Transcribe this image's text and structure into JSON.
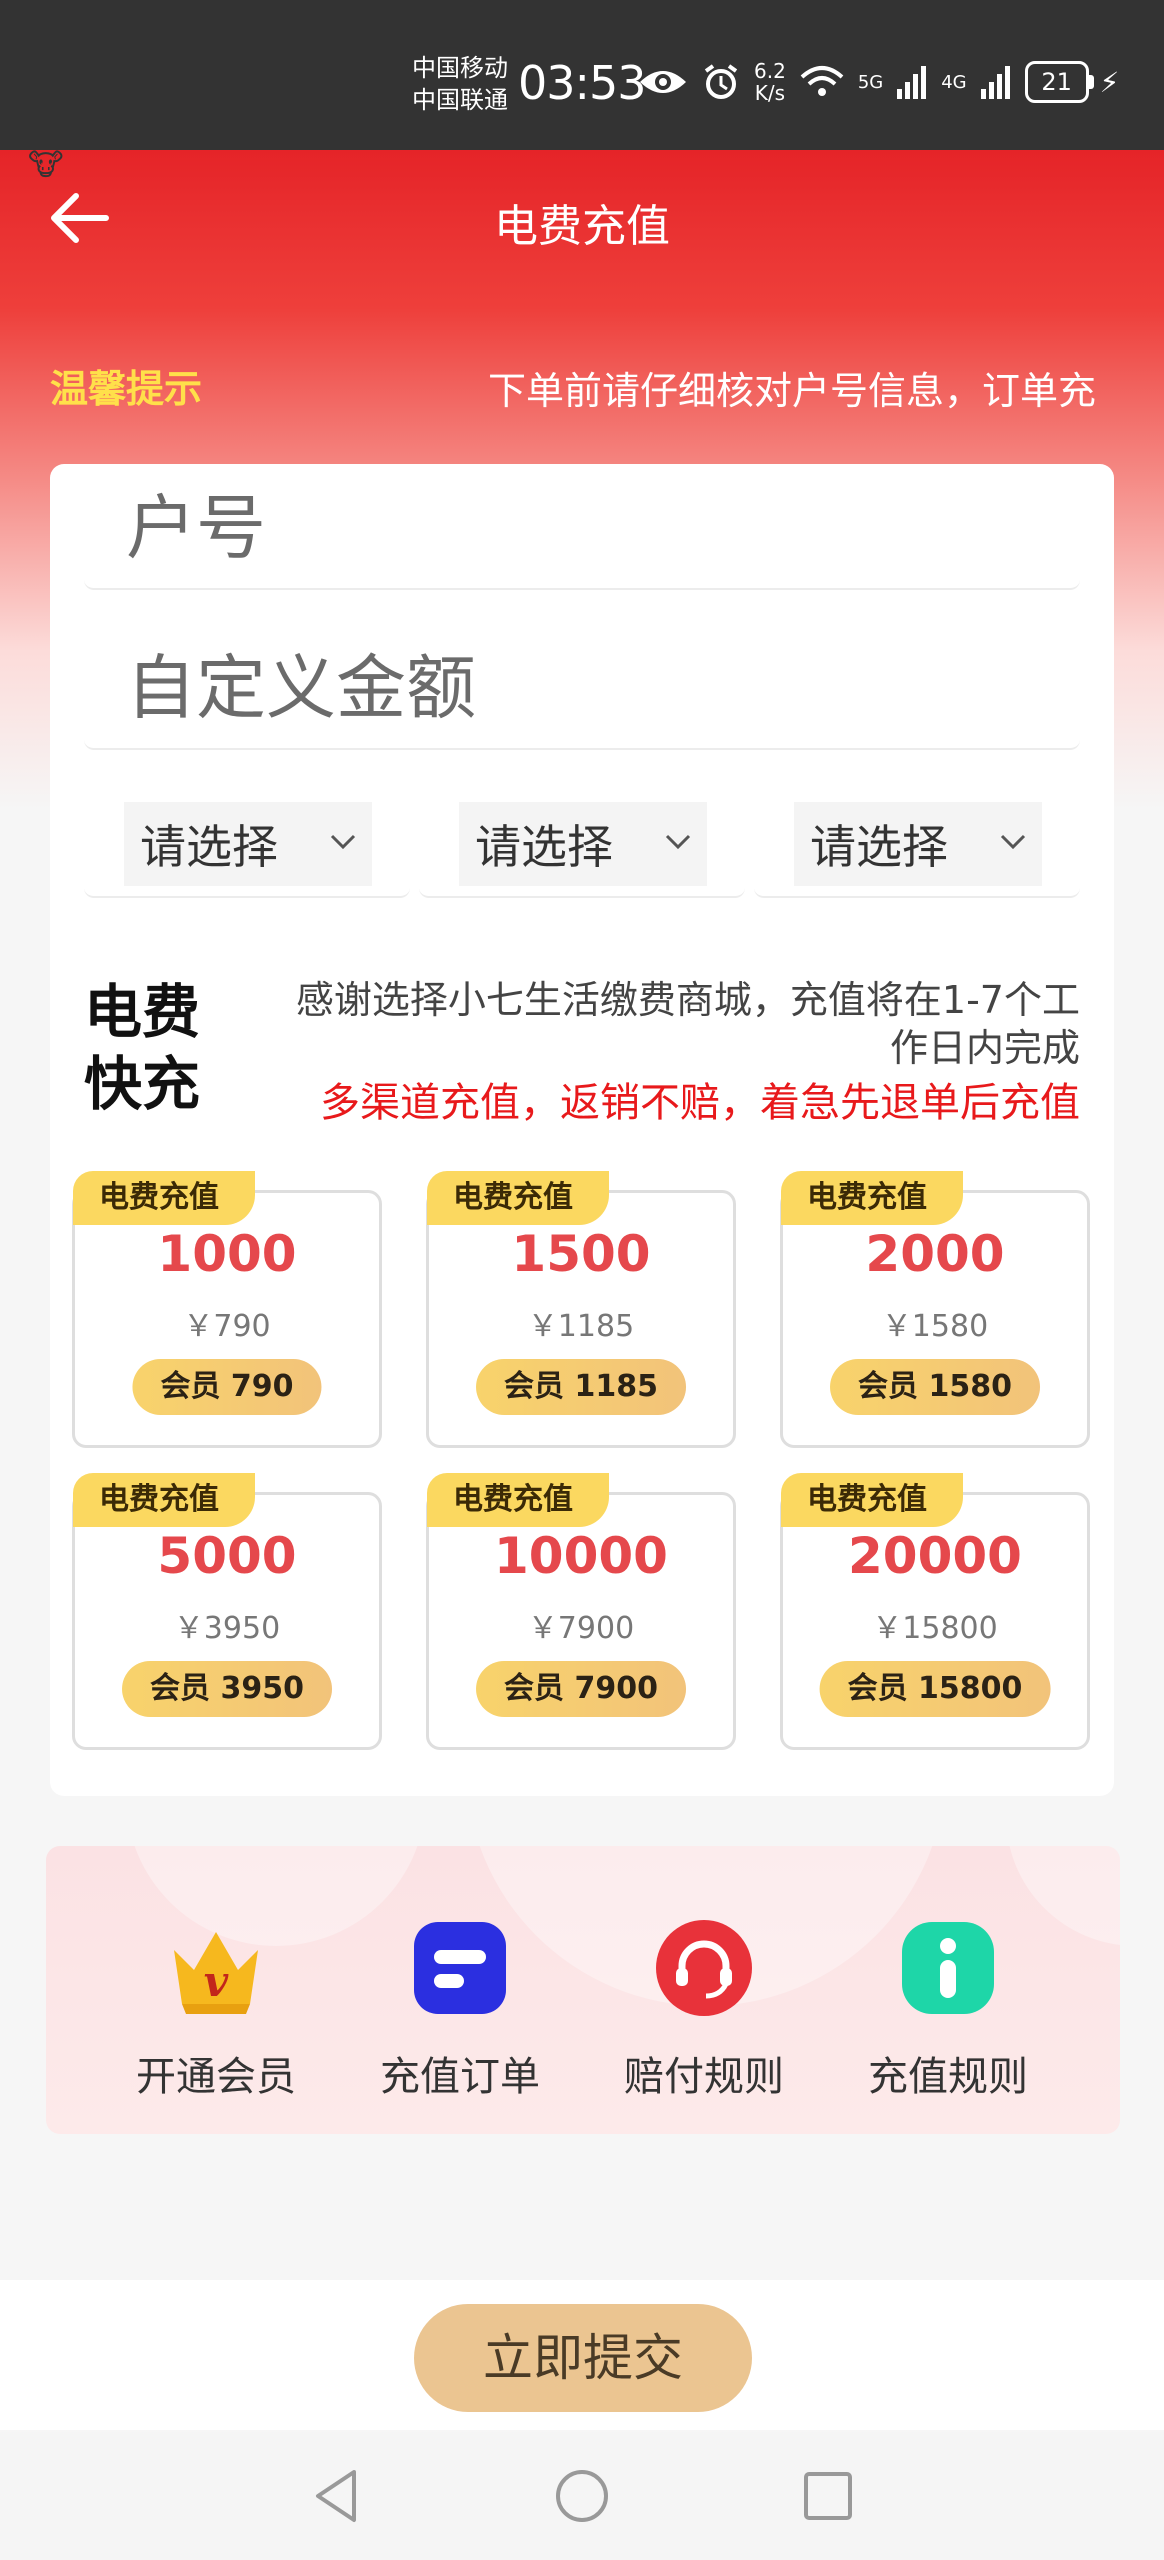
{
  "status_bar": {
    "carrier_1": "中国移动",
    "carrier_2": "中国联通",
    "time": "03:53",
    "speed_value": "6.2",
    "speed_unit": "K/s",
    "net_1": "5G",
    "net_2": "4G",
    "battery": "21"
  },
  "header": {
    "title": "电费充值",
    "tip_label": "温馨提示",
    "tip_text": "下单前请仔细核对户号信息，订单充"
  },
  "form": {
    "account_placeholder": "户号",
    "amount_placeholder": "自定义金额",
    "select_1": "请选择",
    "select_2": "请选择",
    "select_3": "请选择"
  },
  "quick": {
    "title": "电费快充",
    "desc": "感谢选择小七生活缴费商城，充值将在1-7个工作日内完成",
    "warning": "多渠道充值，返销不赔，着急先退单后充值"
  },
  "products": [
    {
      "badge": "电费充值",
      "amount": "1000",
      "price": "￥790",
      "member": "会员 790"
    },
    {
      "badge": "电费充值",
      "amount": "1500",
      "price": "￥1185",
      "member": "会员 1185"
    },
    {
      "badge": "电费充值",
      "amount": "2000",
      "price": "￥1580",
      "member": "会员 1580"
    },
    {
      "badge": "电费充值",
      "amount": "5000",
      "price": "￥3950",
      "member": "会员 3950"
    },
    {
      "badge": "电费充值",
      "amount": "10000",
      "price": "￥7900",
      "member": "会员 7900"
    },
    {
      "badge": "电费充值",
      "amount": "20000",
      "price": "￥15800",
      "member": "会员 15800"
    }
  ],
  "shortcuts": [
    {
      "label": "开通会员",
      "icon": "crown-vip-icon"
    },
    {
      "label": "充值订单",
      "icon": "order-list-icon"
    },
    {
      "label": "赔付规则",
      "icon": "customer-service-icon"
    },
    {
      "label": "充值规则",
      "icon": "info-icon"
    }
  ],
  "submit_label": "立即提交",
  "colors": {
    "brand_red": "#e52428",
    "tip_yellow": "#ffe04a",
    "amount_red": "#e5484c",
    "warning_red": "#e8191b",
    "badge_yellow": "#fbd860",
    "submit_gold": "#ebc591"
  }
}
